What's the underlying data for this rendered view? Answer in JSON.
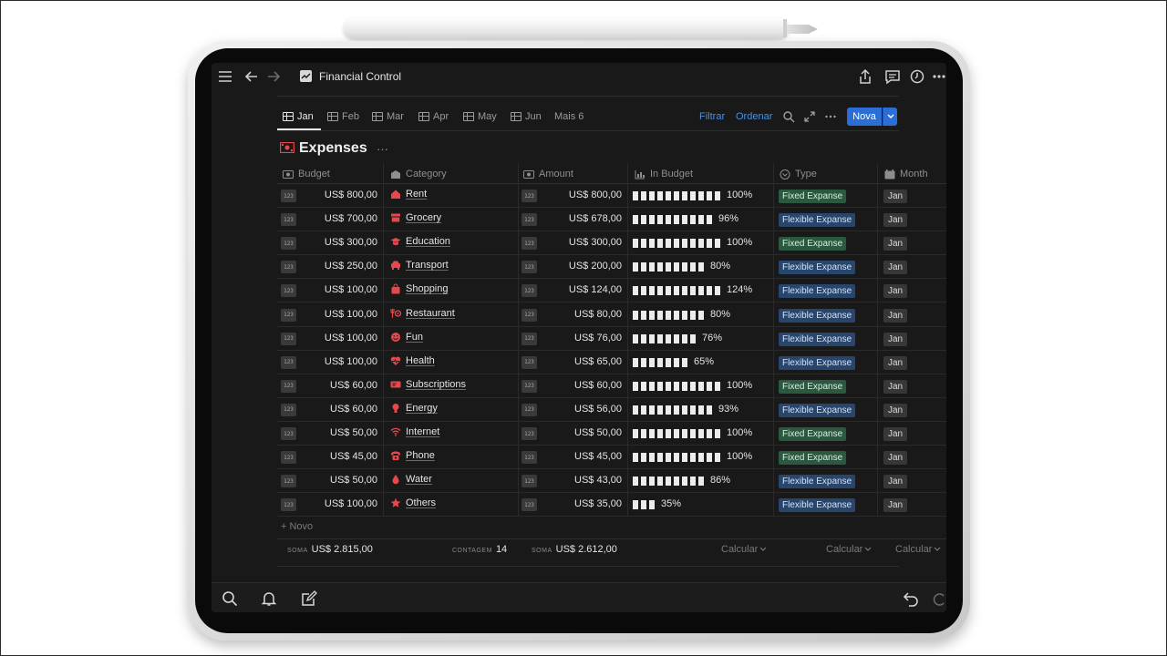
{
  "app": {
    "title": "Financial Control"
  },
  "tabs": [
    {
      "label": "Jan",
      "active": true
    },
    {
      "label": "Feb"
    },
    {
      "label": "Mar"
    },
    {
      "label": "Apr"
    },
    {
      "label": "May"
    },
    {
      "label": "Jun"
    },
    {
      "label": "Mais 6"
    }
  ],
  "toolbar": {
    "filter_label": "Filtrar",
    "sort_label": "Ordenar",
    "new_label": "Nova"
  },
  "database": {
    "title": "Expenses"
  },
  "columns": {
    "budget": "Budget",
    "category": "Category",
    "amount": "Amount",
    "in_budget": "In Budget",
    "type": "Type",
    "month": "Month"
  },
  "number_badge": "123",
  "rows": [
    {
      "budget": "US$ 800,00",
      "category": "Rent",
      "icon": "house-icon",
      "amount": "US$ 800,00",
      "bars": 11,
      "pct": "100%",
      "type": "Fixed Expanse",
      "month": "Jan"
    },
    {
      "budget": "US$ 700,00",
      "category": "Grocery",
      "icon": "store-icon",
      "amount": "US$ 678,00",
      "bars": 10,
      "pct": "96%",
      "type": "Flexible Expanse",
      "month": "Jan"
    },
    {
      "budget": "US$ 300,00",
      "category": "Education",
      "icon": "graduation-cap-icon",
      "amount": "US$ 300,00",
      "bars": 11,
      "pct": "100%",
      "type": "Fixed Expanse",
      "month": "Jan"
    },
    {
      "budget": "US$ 250,00",
      "category": "Transport",
      "icon": "car-icon",
      "amount": "US$ 200,00",
      "bars": 9,
      "pct": "80%",
      "type": "Flexible Expanse",
      "month": "Jan"
    },
    {
      "budget": "US$ 100,00",
      "category": "Shopping",
      "icon": "shopping-bag-icon",
      "amount": "US$ 124,00",
      "bars": 11,
      "pct": "124%",
      "type": "Flexible Expanse",
      "month": "Jan"
    },
    {
      "budget": "US$ 100,00",
      "category": "Restaurant",
      "icon": "utensils-icon",
      "amount": "US$ 80,00",
      "bars": 9,
      "pct": "80%",
      "type": "Flexible Expanse",
      "month": "Jan"
    },
    {
      "budget": "US$ 100,00",
      "category": "Fun",
      "icon": "smiley-icon",
      "amount": "US$ 76,00",
      "bars": 8,
      "pct": "76%",
      "type": "Flexible Expanse",
      "month": "Jan"
    },
    {
      "budget": "US$ 100,00",
      "category": "Health",
      "icon": "heart-pulse-icon",
      "amount": "US$ 65,00",
      "bars": 7,
      "pct": "65%",
      "type": "Flexible Expanse",
      "month": "Jan"
    },
    {
      "budget": "US$ 60,00",
      "category": "Subscriptions",
      "icon": "ticket-icon",
      "amount": "US$ 60,00",
      "bars": 11,
      "pct": "100%",
      "type": "Fixed Expanse",
      "month": "Jan"
    },
    {
      "budget": "US$ 60,00",
      "category": "Energy",
      "icon": "lightbulb-icon",
      "amount": "US$ 56,00",
      "bars": 10,
      "pct": "93%",
      "type": "Flexible Expanse",
      "month": "Jan"
    },
    {
      "budget": "US$ 50,00",
      "category": "Internet",
      "icon": "wifi-icon",
      "amount": "US$ 50,00",
      "bars": 11,
      "pct": "100%",
      "type": "Fixed Expanse",
      "month": "Jan"
    },
    {
      "budget": "US$ 45,00",
      "category": "Phone",
      "icon": "phone-icon",
      "amount": "US$ 45,00",
      "bars": 11,
      "pct": "100%",
      "type": "Fixed Expanse",
      "month": "Jan"
    },
    {
      "budget": "US$ 50,00",
      "category": "Water",
      "icon": "droplet-icon",
      "amount": "US$ 43,00",
      "bars": 9,
      "pct": "86%",
      "type": "Flexible Expanse",
      "month": "Jan"
    },
    {
      "budget": "US$ 100,00",
      "category": "Others",
      "icon": "star-icon",
      "amount": "US$ 35,00",
      "bars": 3,
      "pct": "35%",
      "type": "Flexible Expanse",
      "month": "Jan"
    }
  ],
  "new_row_label": "Novo",
  "footer": {
    "budget_label": "SOMA",
    "budget_value": "US$ 2.815,00",
    "count_label": "CONTAGEM",
    "count_value": "14",
    "amount_label": "SOMA",
    "amount_value": "US$ 2.612,00",
    "calc_label": "Calcular"
  },
  "colors": {
    "accent": "#2b6fd6",
    "link": "#4a90e2",
    "icon_red": "#e5484d",
    "fixed_tag": "#2b593f",
    "flexible_tag": "#28456c"
  }
}
